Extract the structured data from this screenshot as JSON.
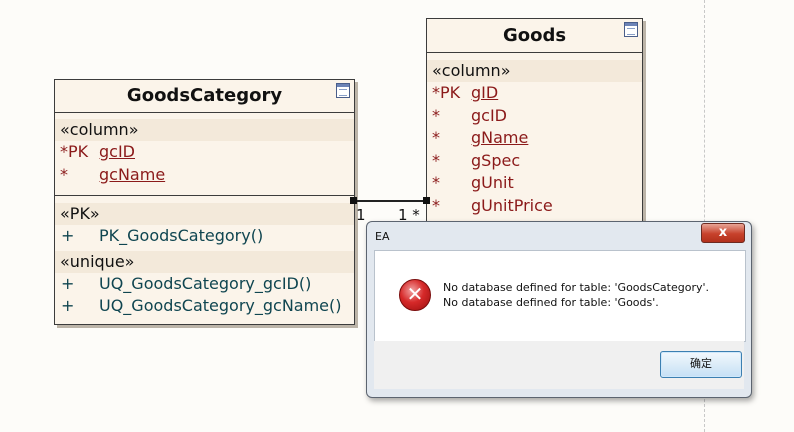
{
  "goods_category": {
    "title": "GoodsCategory",
    "column_stereotype": "«column»",
    "columns": [
      {
        "marker": "*PK",
        "name": "gcID"
      },
      {
        "marker": "*",
        "name": "gcName"
      }
    ],
    "pk_stereotype": "«PK»",
    "pk_ops": [
      {
        "marker": "+",
        "name": "PK_GoodsCategory()"
      }
    ],
    "unique_stereotype": "«unique»",
    "unique_ops": [
      {
        "marker": "+",
        "name": "UQ_GoodsCategory_gcID()"
      },
      {
        "marker": "+",
        "name": "UQ_GoodsCategory_gcName()"
      }
    ]
  },
  "goods": {
    "title": "Goods",
    "column_stereotype": "«column»",
    "columns": [
      {
        "marker": "*PK",
        "name": "gID"
      },
      {
        "marker": "*",
        "name": "gcID"
      },
      {
        "marker": "*",
        "name": "gName"
      },
      {
        "marker": "*",
        "name": "gSpec"
      },
      {
        "marker": "*",
        "name": "gUnit"
      },
      {
        "marker": "*",
        "name": "gUnitPrice"
      }
    ]
  },
  "connector": {
    "source_multiplicity": "1",
    "target_multiplicity": "1 *"
  },
  "dialog": {
    "title": "EA",
    "close_label": "x",
    "message_line_1": "No database defined for table: 'GoodsCategory'.",
    "message_line_2": "No database defined for table: 'Goods'.",
    "ok_label": "确定"
  },
  "colors": {
    "column_text": "#8b1a1a",
    "operation_text": "#0f4550",
    "table_bg": "#fbf4ea"
  }
}
